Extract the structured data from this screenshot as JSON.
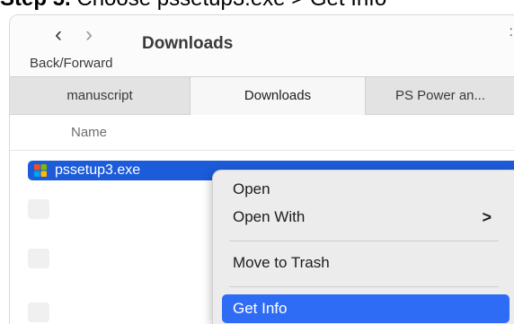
{
  "heading": {
    "step": "Step 5.",
    "text": " Choose pssetup3.exe > Get Info"
  },
  "toolbar": {
    "back_glyph": "‹",
    "forward_glyph": "›",
    "nav_label": "Back/Forward",
    "title": "Downloads",
    "edge_glyph": ":"
  },
  "tabs": [
    {
      "label": "manuscript"
    },
    {
      "label": "Downloads",
      "active": true
    },
    {
      "label": "PS Power an..."
    }
  ],
  "list": {
    "column_header": "Name",
    "selected_file": {
      "name": "pssetup3.exe",
      "icon": "windows-exe-icon"
    }
  },
  "context_menu": {
    "items": [
      {
        "label": "Open"
      },
      {
        "label": "Open With",
        "submenu_glyph": ">"
      },
      {
        "label": "Move to Trash"
      },
      {
        "label": "Get Info",
        "highlighted": true
      }
    ]
  },
  "colors": {
    "selection": "#1c5bd9",
    "menu_highlight": "#2f6cf5",
    "menu_bg": "#ececec"
  }
}
